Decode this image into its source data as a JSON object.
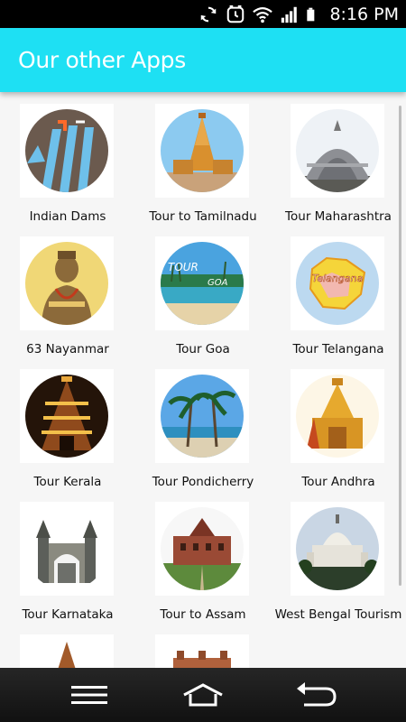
{
  "status_bar": {
    "time": "8:16 PM",
    "icons": [
      "sync-icon",
      "alarm-icon",
      "wifi-icon",
      "signal-icon",
      "battery-icon"
    ]
  },
  "app_bar": {
    "title": "Our other Apps",
    "background_color": "#1ee0f3"
  },
  "apps": [
    {
      "label": "Indian Dams",
      "icon": "dam-icon"
    },
    {
      "label": "Tour to Tamilnadu",
      "icon": "temple-icon"
    },
    {
      "label": "Tour Maharashtra",
      "icon": "stupa-icon"
    },
    {
      "label": "63 Nayanmar",
      "icon": "saint-icon"
    },
    {
      "label": "Tour Goa",
      "icon": "beach-icon"
    },
    {
      "label": "Tour Telangana",
      "icon": "map-icon"
    },
    {
      "label": "Tour Kerala",
      "icon": "temple-tower-icon"
    },
    {
      "label": "Tour Pondicherry",
      "icon": "palm-beach-icon"
    },
    {
      "label": "Tour Andhra",
      "icon": "golden-temple-icon"
    },
    {
      "label": "Tour Karnataka",
      "icon": "palace-gate-icon"
    },
    {
      "label": "Tour to Assam",
      "icon": "assam-palace-icon"
    },
    {
      "label": "West Bengal Tourism",
      "icon": "memorial-icon"
    },
    {
      "label": "",
      "icon": "temple-icon"
    },
    {
      "label": "",
      "icon": "fort-icon"
    }
  ],
  "nav_bar": {
    "buttons": [
      "menu-icon",
      "home-icon",
      "back-icon"
    ]
  }
}
